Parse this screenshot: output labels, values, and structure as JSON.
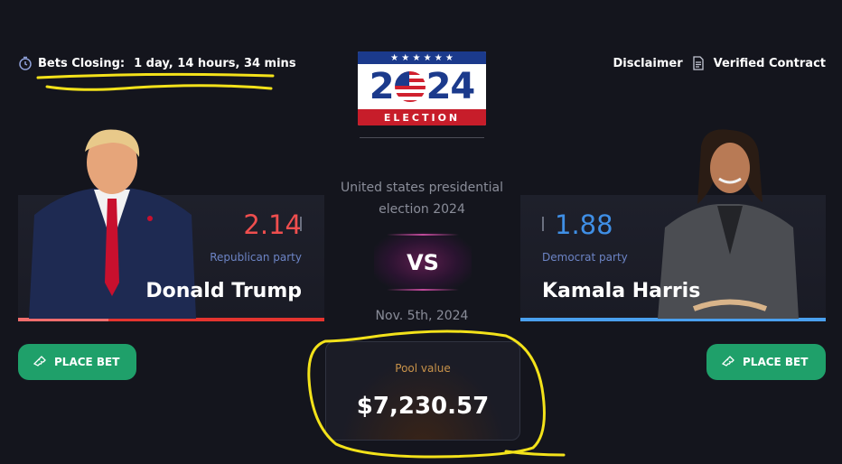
{
  "header": {
    "closing_label": "Bets Closing:",
    "closing_value": "1 day, 14 hours, 34 mins",
    "disclaimer": "Disclaimer",
    "verified": "Verified Contract"
  },
  "logo": {
    "year_digits": [
      "2",
      "24"
    ],
    "band": "ELECTION",
    "stars": "★ ★ ★ ★ ★ ★"
  },
  "event": {
    "title": "United states presidential election 2024",
    "vs": "VS",
    "date": "Nov. 5th, 2024"
  },
  "pool": {
    "label": "Pool value",
    "value": "$7,230.57"
  },
  "candidates": {
    "left": {
      "odds": "2.14",
      "party": "Republican party",
      "name": "Donald Trump",
      "accent": "#e5342f"
    },
    "right": {
      "odds": "1.88",
      "party": "Democrat party",
      "name": "Kamala Harris",
      "accent": "#4aa0ef"
    }
  },
  "actions": {
    "place_bet_left": "PLACE BET",
    "place_bet_right": "PLACE BET"
  },
  "icons": [
    "clock-icon",
    "document-icon",
    "ticket-icon"
  ],
  "colors": {
    "background": "#14151d",
    "button": "#1fa06a",
    "pool_label": "#c8924a",
    "annotation": "#f3e21a"
  }
}
